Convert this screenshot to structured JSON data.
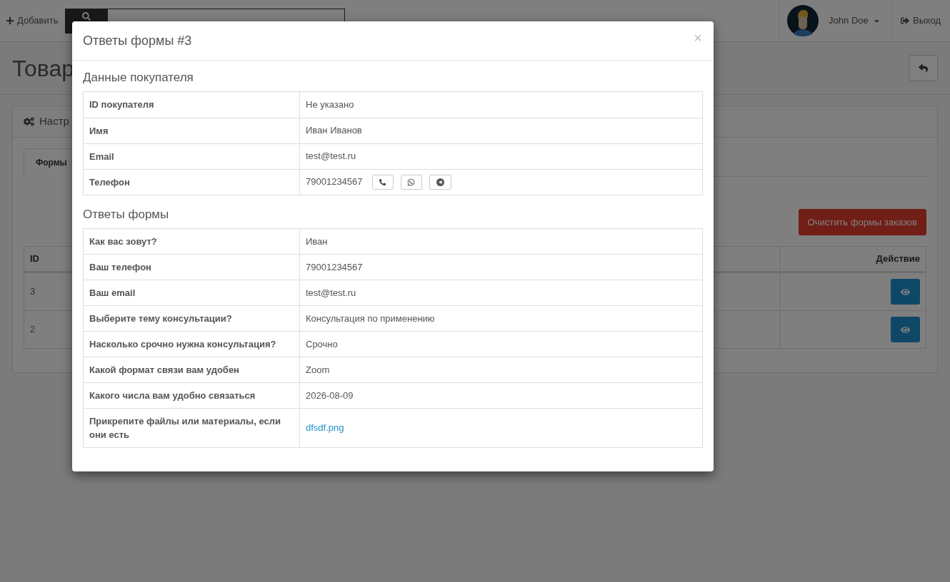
{
  "header": {
    "add_button": "Добавить",
    "user_name": "John Doe",
    "logout": "Выход"
  },
  "page": {
    "title": "Товар"
  },
  "panel": {
    "heading": "Настр",
    "tabs": [
      {
        "label": "Формы",
        "selected": true
      }
    ],
    "clear_button": "Очистить формы заказов",
    "table": {
      "columns": [
        "ID",
        "Действие"
      ],
      "rows": [
        {
          "id": "3"
        },
        {
          "id": "2"
        }
      ]
    }
  },
  "modal": {
    "title": "Ответы формы #3",
    "close": "×",
    "sections": [
      {
        "heading": "Данные покупателя",
        "rows": [
          {
            "kind": "text",
            "label": "ID покупателя",
            "value": "Не указано"
          },
          {
            "kind": "text",
            "label": "Имя",
            "value": "Иван Иванов"
          },
          {
            "kind": "text",
            "label": "Email",
            "value": "test@test.ru"
          },
          {
            "kind": "phone",
            "label": "Телефон",
            "value": "79001234567"
          }
        ]
      },
      {
        "heading": "Ответы формы",
        "rows": [
          {
            "kind": "text",
            "label": "Как вас зовут?",
            "value": "Иван"
          },
          {
            "kind": "text",
            "label": "Ваш телефон",
            "value": "79001234567"
          },
          {
            "kind": "text",
            "label": "Ваш email",
            "value": "test@test.ru"
          },
          {
            "kind": "text",
            "label": "Выберите тему консультации?",
            "value": "Консультация по применению"
          },
          {
            "kind": "text",
            "label": "Насколько срочно нужна консультация?",
            "value": "Срочно"
          },
          {
            "kind": "text",
            "label": "Какой формат связи вам удобен",
            "value": "Zoom"
          },
          {
            "kind": "text",
            "label": "Какого числа вам удобно связаться",
            "value": "2026-08-09"
          },
          {
            "kind": "link",
            "label": "Прикрепите файлы или материалы, если они есть",
            "value": "dfsdf.png"
          }
        ]
      }
    ]
  }
}
